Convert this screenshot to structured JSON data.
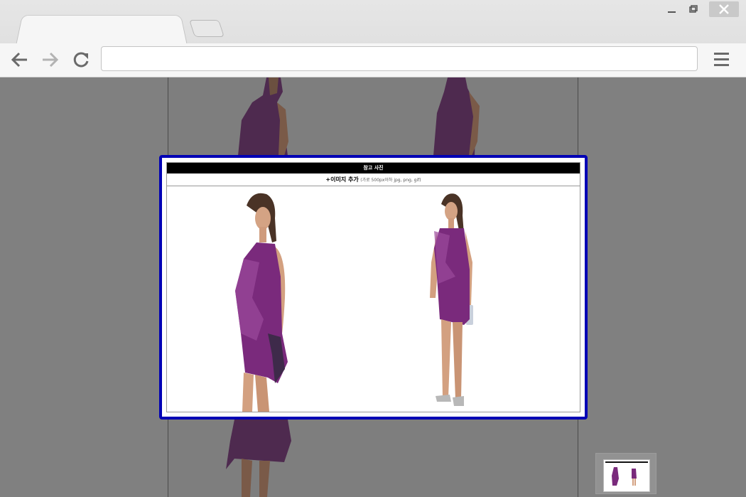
{
  "browser": {
    "address_value": "",
    "icons": {
      "back": "arrow-left-icon",
      "forward": "arrow-right-icon",
      "reload": "reload-icon",
      "menu": "hamburger-menu-icon",
      "minimize": "minimize-icon",
      "restore": "restore-icon",
      "close": "close-icon"
    }
  },
  "modal": {
    "title": "참고 사진",
    "add_image_label": "+이미지 추가",
    "add_image_note": "(가로 500px이하 jpg, png, gif)",
    "photos": [
      {
        "alt": "photo-model-purple-dress-side"
      },
      {
        "alt": "photo-model-purple-dress-front"
      }
    ]
  },
  "colors": {
    "modal_border": "#0000b5",
    "dress": "#7a2a7c",
    "overlay": "#808080"
  }
}
